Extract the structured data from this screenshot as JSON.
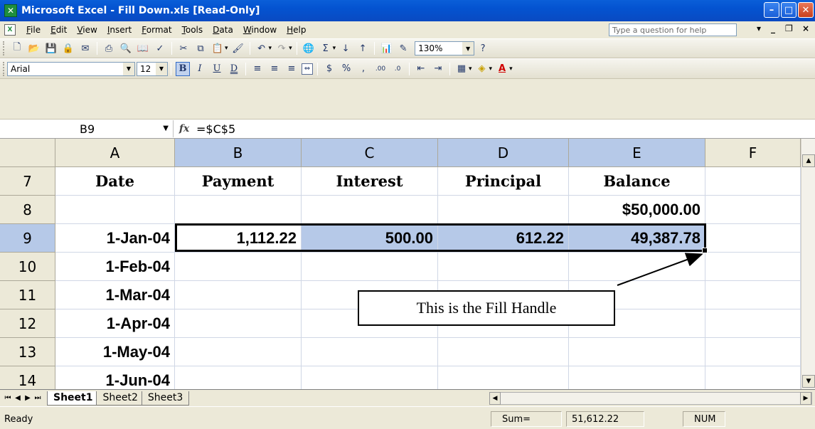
{
  "window": {
    "app_icon": "excel-logo-icon",
    "title": "Microsoft Excel - Fill Down.xls  [Read-Only]",
    "minimize_label": "–",
    "maximize_label": "□",
    "close_label": "✕"
  },
  "menu": {
    "items": [
      "File",
      "Edit",
      "View",
      "Insert",
      "Format",
      "Tools",
      "Data",
      "Window",
      "Help"
    ],
    "help_placeholder": "Type a question for help"
  },
  "toolbar_format": {
    "font_name": "Arial",
    "font_size": "12",
    "zoom": "130%"
  },
  "formula_bar": {
    "name_box": "B9",
    "fx_label": "fx",
    "formula": "=$C$5"
  },
  "grid": {
    "columns": [
      "A",
      "B",
      "C",
      "D",
      "E",
      "F"
    ],
    "selected_columns": [
      "B",
      "C",
      "D",
      "E"
    ],
    "rows": [
      {
        "num": "7",
        "cells": [
          "Date",
          "Payment",
          "Interest",
          "Principal",
          "Balance",
          ""
        ]
      },
      {
        "num": "8",
        "cells": [
          "",
          "",
          "",
          "",
          "$50,000.00",
          ""
        ]
      },
      {
        "num": "9",
        "cells": [
          "1-Jan-04",
          "1,112.22",
          "500.00",
          "612.22",
          "49,387.78",
          ""
        ]
      },
      {
        "num": "10",
        "cells": [
          "1-Feb-04",
          "",
          "",
          "",
          "",
          ""
        ]
      },
      {
        "num": "11",
        "cells": [
          "1-Mar-04",
          "",
          "",
          "",
          "",
          ""
        ]
      },
      {
        "num": "12",
        "cells": [
          "1-Apr-04",
          "",
          "",
          "",
          "",
          ""
        ]
      },
      {
        "num": "13",
        "cells": [
          "1-May-04",
          "",
          "",
          "",
          "",
          ""
        ]
      },
      {
        "num": "14",
        "cells": [
          "1-Jun-04",
          "",
          "",
          "",
          "",
          ""
        ]
      }
    ],
    "selected_row": "9",
    "selection_color": "#b6c9e8"
  },
  "callout": {
    "text": "This is the Fill Handle"
  },
  "sheets": {
    "tabs": [
      "Sheet1",
      "Sheet2",
      "Sheet3"
    ],
    "active": "Sheet1"
  },
  "status": {
    "ready": "Ready",
    "sum_label": "Sum=",
    "sum_value": "51,612.22",
    "num_indicator": "NUM"
  }
}
